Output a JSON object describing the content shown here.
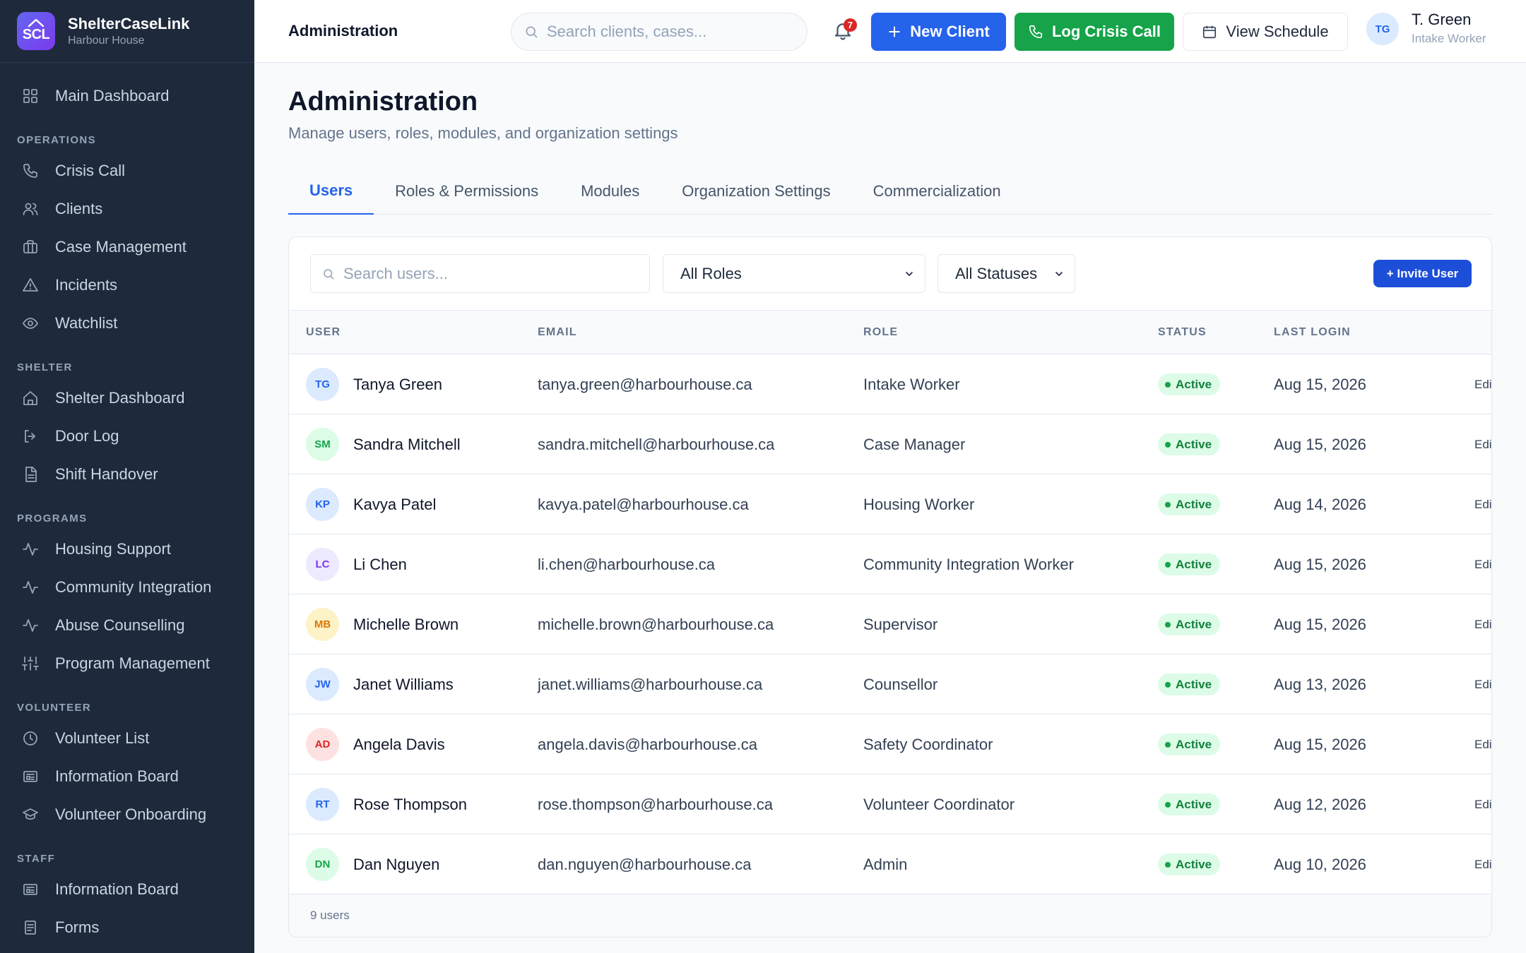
{
  "brand": {
    "logo_text": "SCL",
    "name": "ShelterCaseLink",
    "org": "Harbour House"
  },
  "sidebar": {
    "main_item": {
      "label": "Main Dashboard",
      "icon": "grid-icon"
    },
    "sections": [
      {
        "title": "OPERATIONS",
        "items": [
          {
            "label": "Crisis Call",
            "icon": "phone-icon"
          },
          {
            "label": "Clients",
            "icon": "users-icon"
          },
          {
            "label": "Case Management",
            "icon": "briefcase-icon"
          },
          {
            "label": "Incidents",
            "icon": "alert-triangle-icon"
          },
          {
            "label": "Watchlist",
            "icon": "eye-icon"
          }
        ]
      },
      {
        "title": "SHELTER",
        "items": [
          {
            "label": "Shelter Dashboard",
            "icon": "home-icon"
          },
          {
            "label": "Door Log",
            "icon": "door-icon"
          },
          {
            "label": "Shift Handover",
            "icon": "document-icon"
          }
        ]
      },
      {
        "title": "PROGRAMS",
        "items": [
          {
            "label": "Housing Support",
            "icon": "activity-icon"
          },
          {
            "label": "Community Integration",
            "icon": "activity-icon"
          },
          {
            "label": "Abuse Counselling",
            "icon": "activity-icon"
          },
          {
            "label": "Program Management",
            "icon": "sliders-icon"
          }
        ]
      },
      {
        "title": "VOLUNTEER",
        "items": [
          {
            "label": "Volunteer List",
            "icon": "clock-icon"
          },
          {
            "label": "Information Board",
            "icon": "newspaper-icon"
          },
          {
            "label": "Volunteer Onboarding",
            "icon": "graduation-icon"
          }
        ]
      },
      {
        "title": "STAFF",
        "items": [
          {
            "label": "Information Board",
            "icon": "newspaper-icon"
          },
          {
            "label": "Forms",
            "icon": "form-icon"
          }
        ]
      }
    ]
  },
  "topbar": {
    "title": "Administration",
    "search_placeholder": "Search clients, cases...",
    "notification_count": "7",
    "new_client_label": "New Client",
    "log_crisis_label": "Log Crisis Call",
    "view_schedule_label": "View Schedule",
    "user": {
      "initials": "TG",
      "name": "T. Green",
      "role": "Intake Worker"
    }
  },
  "page": {
    "title": "Administration",
    "subtitle": "Manage users, roles, modules, and organization settings",
    "tabs": [
      {
        "label": "Users",
        "active": true
      },
      {
        "label": "Roles & Permissions",
        "active": false
      },
      {
        "label": "Modules",
        "active": false
      },
      {
        "label": "Organization Settings",
        "active": false
      },
      {
        "label": "Commercialization",
        "active": false
      }
    ]
  },
  "users_table": {
    "search_placeholder": "Search users...",
    "role_filter": "All Roles",
    "status_filter": "All Statuses",
    "invite_label": "+ Invite User",
    "columns": [
      "USER",
      "EMAIL",
      "ROLE",
      "STATUS",
      "LAST LOGIN"
    ],
    "edit_label": "Edit",
    "rows": [
      {
        "initials": "TG",
        "name": "Tanya Green",
        "email": "tanya.green@harbourhouse.ca",
        "role": "Intake Worker",
        "status": "Active",
        "last_login": "Aug 15, 2026",
        "avatar_bg": "#dbeafe",
        "avatar_fg": "#2563eb"
      },
      {
        "initials": "SM",
        "name": "Sandra Mitchell",
        "email": "sandra.mitchell@harbourhouse.ca",
        "role": "Case Manager",
        "status": "Active",
        "last_login": "Aug 15, 2026",
        "avatar_bg": "#dcfce7",
        "avatar_fg": "#16a34a"
      },
      {
        "initials": "KP",
        "name": "Kavya Patel",
        "email": "kavya.patel@harbourhouse.ca",
        "role": "Housing Worker",
        "status": "Active",
        "last_login": "Aug 14, 2026",
        "avatar_bg": "#dbeafe",
        "avatar_fg": "#2563eb"
      },
      {
        "initials": "LC",
        "name": "Li Chen",
        "email": "li.chen@harbourhouse.ca",
        "role": "Community Integration Worker",
        "status": "Active",
        "last_login": "Aug 15, 2026",
        "avatar_bg": "#ede9fe",
        "avatar_fg": "#7c3aed"
      },
      {
        "initials": "MB",
        "name": "Michelle Brown",
        "email": "michelle.brown@harbourhouse.ca",
        "role": "Supervisor",
        "status": "Active",
        "last_login": "Aug 15, 2026",
        "avatar_bg": "#fef3c7",
        "avatar_fg": "#d97706"
      },
      {
        "initials": "JW",
        "name": "Janet Williams",
        "email": "janet.williams@harbourhouse.ca",
        "role": "Counsellor",
        "status": "Active",
        "last_login": "Aug 13, 2026",
        "avatar_bg": "#dbeafe",
        "avatar_fg": "#2563eb"
      },
      {
        "initials": "AD",
        "name": "Angela Davis",
        "email": "angela.davis@harbourhouse.ca",
        "role": "Safety Coordinator",
        "status": "Active",
        "last_login": "Aug 15, 2026",
        "avatar_bg": "#fee2e2",
        "avatar_fg": "#dc2626"
      },
      {
        "initials": "RT",
        "name": "Rose Thompson",
        "email": "rose.thompson@harbourhouse.ca",
        "role": "Volunteer Coordinator",
        "status": "Active",
        "last_login": "Aug 12, 2026",
        "avatar_bg": "#dbeafe",
        "avatar_fg": "#2563eb"
      },
      {
        "initials": "DN",
        "name": "Dan Nguyen",
        "email": "dan.nguyen@harbourhouse.ca",
        "role": "Admin",
        "status": "Active",
        "last_login": "Aug 10, 2026",
        "avatar_bg": "#dcfce7",
        "avatar_fg": "#16a34a"
      }
    ],
    "footer": "9 users"
  }
}
